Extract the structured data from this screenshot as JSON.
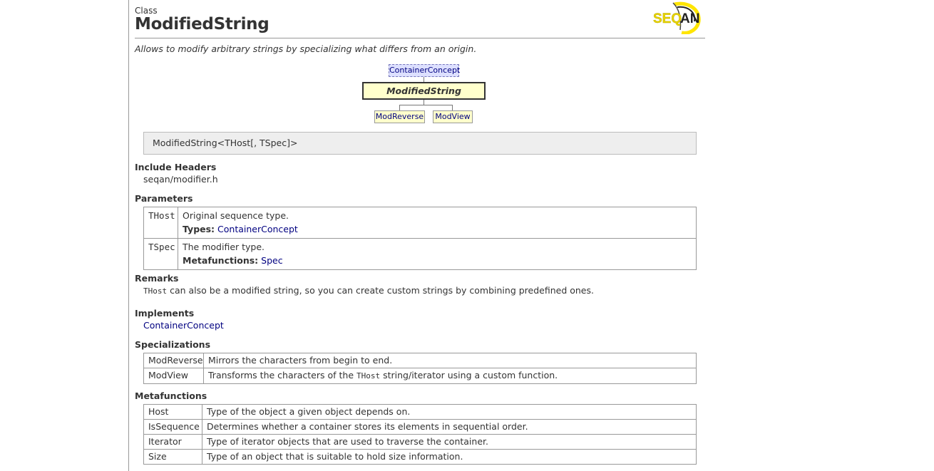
{
  "header": {
    "kind": "Class",
    "title": "ModifiedString",
    "logo_text": "SEQAN"
  },
  "summary": "Allows to modify arbitrary strings by specializing what differs from an origin.",
  "diagram": {
    "concept": "ContainerConcept",
    "main": "ModifiedString",
    "children": [
      "ModReverse",
      "ModView"
    ]
  },
  "signature": "ModifiedString<THost[, TSpec]>",
  "include_headers": {
    "heading": "Include Headers",
    "value": "seqan/modifier.h"
  },
  "parameters": {
    "heading": "Parameters",
    "rows": [
      {
        "name": "THost",
        "description": "Original sequence type.",
        "label": "Types:",
        "link": "ContainerConcept"
      },
      {
        "name": "TSpec",
        "description": "The modifier type.",
        "label": "Metafunctions:",
        "link": "Spec"
      }
    ]
  },
  "remarks": {
    "heading": "Remarks",
    "code": "THost",
    "text": " can also be a modified string, so you can create custom strings by combining predefined ones."
  },
  "implements": {
    "heading": "Implements",
    "link": "ContainerConcept"
  },
  "specializations": {
    "heading": "Specializations",
    "rows": [
      {
        "name": "ModReverse",
        "description": "Mirrors the characters from begin to end."
      },
      {
        "name": "ModView",
        "description_before": "Transforms the characters of the ",
        "code": "THost",
        "description_after": " string/iterator using a custom function."
      }
    ]
  },
  "metafunctions": {
    "heading": "Metafunctions",
    "rows": [
      {
        "name": "Host",
        "description": "Type of the object a given object depends on."
      },
      {
        "name": "IsSequence",
        "description": "Determines whether a container stores its elements in sequential order."
      },
      {
        "name": "Iterator",
        "description": "Type of iterator objects that are used to traverse the container."
      },
      {
        "name": "Size",
        "description": "Type of an object that is suitable to hold size information."
      }
    ]
  }
}
